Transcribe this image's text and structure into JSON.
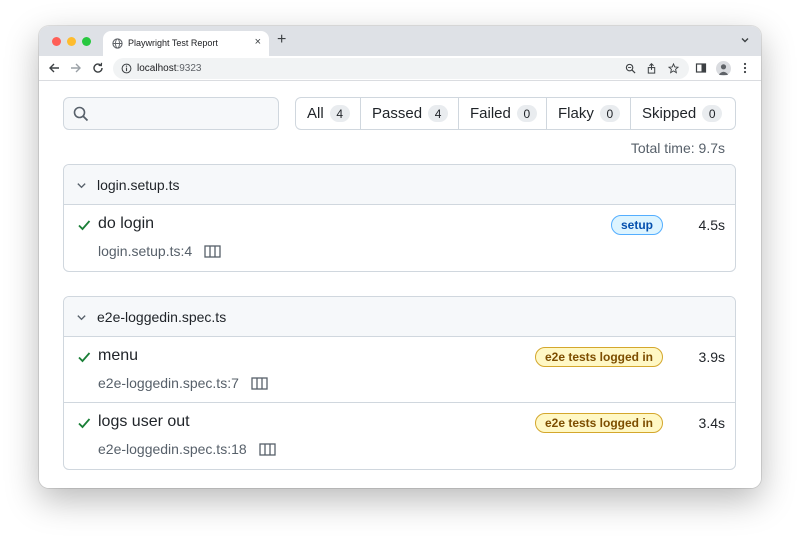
{
  "browser": {
    "tab_title": "Playwright Test Report",
    "tab_close": "×",
    "new_tab": "+",
    "url_host": "localhost",
    "url_port": ":9323"
  },
  "filters": [
    {
      "label": "All",
      "count": "4"
    },
    {
      "label": "Passed",
      "count": "4"
    },
    {
      "label": "Failed",
      "count": "0"
    },
    {
      "label": "Flaky",
      "count": "0"
    },
    {
      "label": "Skipped",
      "count": "0"
    }
  ],
  "total_time": "Total time: 9.7s",
  "files": [
    {
      "name": "login.setup.ts",
      "tests": [
        {
          "title": "do login",
          "location": "login.setup.ts:4",
          "tag": "setup",
          "duration": "4.5s",
          "status": "passed"
        }
      ]
    },
    {
      "name": "e2e-loggedin.spec.ts",
      "tests": [
        {
          "title": "menu",
          "location": "e2e-loggedin.spec.ts:7",
          "tag": "e2e tests logged in",
          "duration": "3.9s",
          "status": "passed"
        },
        {
          "title": "logs user out",
          "location": "e2e-loggedin.spec.ts:18",
          "tag": "e2e tests logged in",
          "duration": "3.4s",
          "status": "passed"
        }
      ]
    }
  ],
  "colors": {
    "passed_check": "#1a7f37",
    "setup_tag_bg": "#ddf4ff",
    "e2e_tag_bg": "#fff8c5"
  }
}
